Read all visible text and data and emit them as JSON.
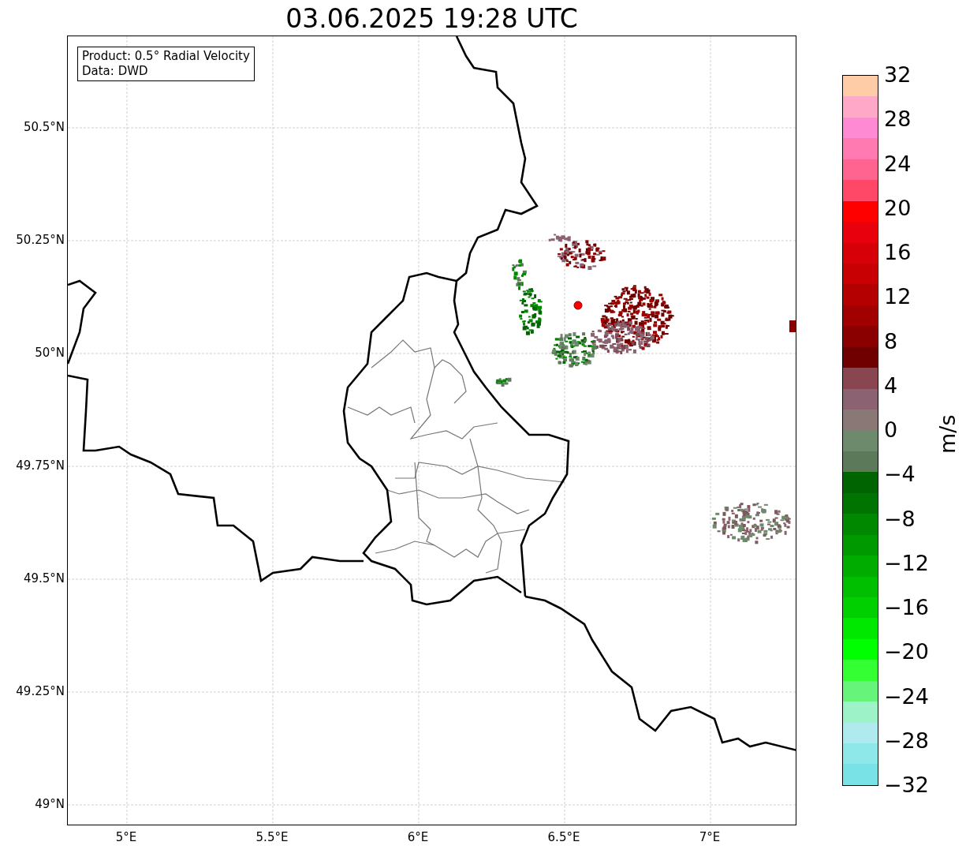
{
  "title": "03.06.2025 19:28 UTC",
  "legend": [
    "Product: 0.5° Radial Velocity",
    "Data: DWD"
  ],
  "y_ticks": [
    "50.5°N",
    "50.25°N",
    "50°N",
    "49.75°N",
    "49.5°N",
    "49.25°N",
    "49°N"
  ],
  "x_ticks": [
    "5°E",
    "5.5°E",
    "6°E",
    "6.5°E",
    "7°E"
  ],
  "colorbar": {
    "label": "m/s",
    "ticks": [
      "32",
      "28",
      "24",
      "20",
      "16",
      "12",
      "8",
      "4",
      "0",
      "−4",
      "−8",
      "−12",
      "−16",
      "−20",
      "−24",
      "−28",
      "−32"
    ],
    "segments": [
      {
        "color": "#ffcca8"
      },
      {
        "color": "#ffa8c8"
      },
      {
        "color": "#ff8ad4"
      },
      {
        "color": "#ff7ab0"
      },
      {
        "color": "#ff6490"
      },
      {
        "color": "#ff4868"
      },
      {
        "color": "#ff0000"
      },
      {
        "color": "#e8000c"
      },
      {
        "color": "#d80008"
      },
      {
        "color": "#c80004"
      },
      {
        "color": "#b40000"
      },
      {
        "color": "#a00000"
      },
      {
        "color": "#8a0000"
      },
      {
        "color": "#700000"
      },
      {
        "color": "#8a4650"
      },
      {
        "color": "#8a6272"
      },
      {
        "color": "#8a7876"
      },
      {
        "color": "#6e8a6c"
      },
      {
        "color": "#5c7a5a"
      },
      {
        "color": "#006400"
      },
      {
        "color": "#007400"
      },
      {
        "color": "#008800"
      },
      {
        "color": "#009a00"
      },
      {
        "color": "#00ac00"
      },
      {
        "color": "#00be00"
      },
      {
        "color": "#00d000"
      },
      {
        "color": "#00e800"
      },
      {
        "color": "#00ff00"
      },
      {
        "color": "#33ff33"
      },
      {
        "color": "#66f57a"
      },
      {
        "color": "#9ef2c8"
      },
      {
        "color": "#aeeaee"
      },
      {
        "color": "#8ee8ea"
      },
      {
        "color": "#78e2e6"
      }
    ]
  }
}
